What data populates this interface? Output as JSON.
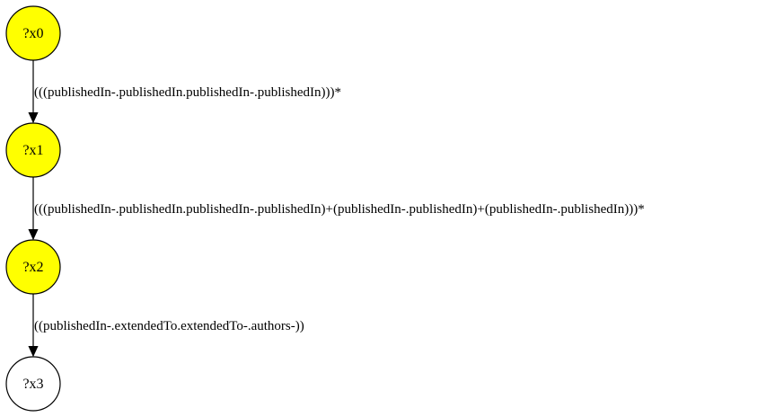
{
  "graph": {
    "nodes": [
      {
        "id": "?x0",
        "label": "?x0",
        "fill": "#ffff00"
      },
      {
        "id": "?x1",
        "label": "?x1",
        "fill": "#ffff00"
      },
      {
        "id": "?x2",
        "label": "?x2",
        "fill": "#ffff00"
      },
      {
        "id": "?x3",
        "label": "?x3",
        "fill": "#ffffff"
      }
    ],
    "edges": [
      {
        "from": "?x0",
        "to": "?x1",
        "label": "(((publishedIn-.publishedIn.publishedIn-.publishedIn)))*"
      },
      {
        "from": "?x1",
        "to": "?x2",
        "label": "(((publishedIn-.publishedIn.publishedIn-.publishedIn)+(publishedIn-.publishedIn)+(publishedIn-.publishedIn)))*"
      },
      {
        "from": "?x2",
        "to": "?x3",
        "label": "((publishedIn-.extendedTo.extendedTo-.authors-))"
      }
    ]
  },
  "colors": {
    "stroke": "#000000",
    "highlight_fill": "#ffff00",
    "plain_fill": "#ffffff"
  }
}
